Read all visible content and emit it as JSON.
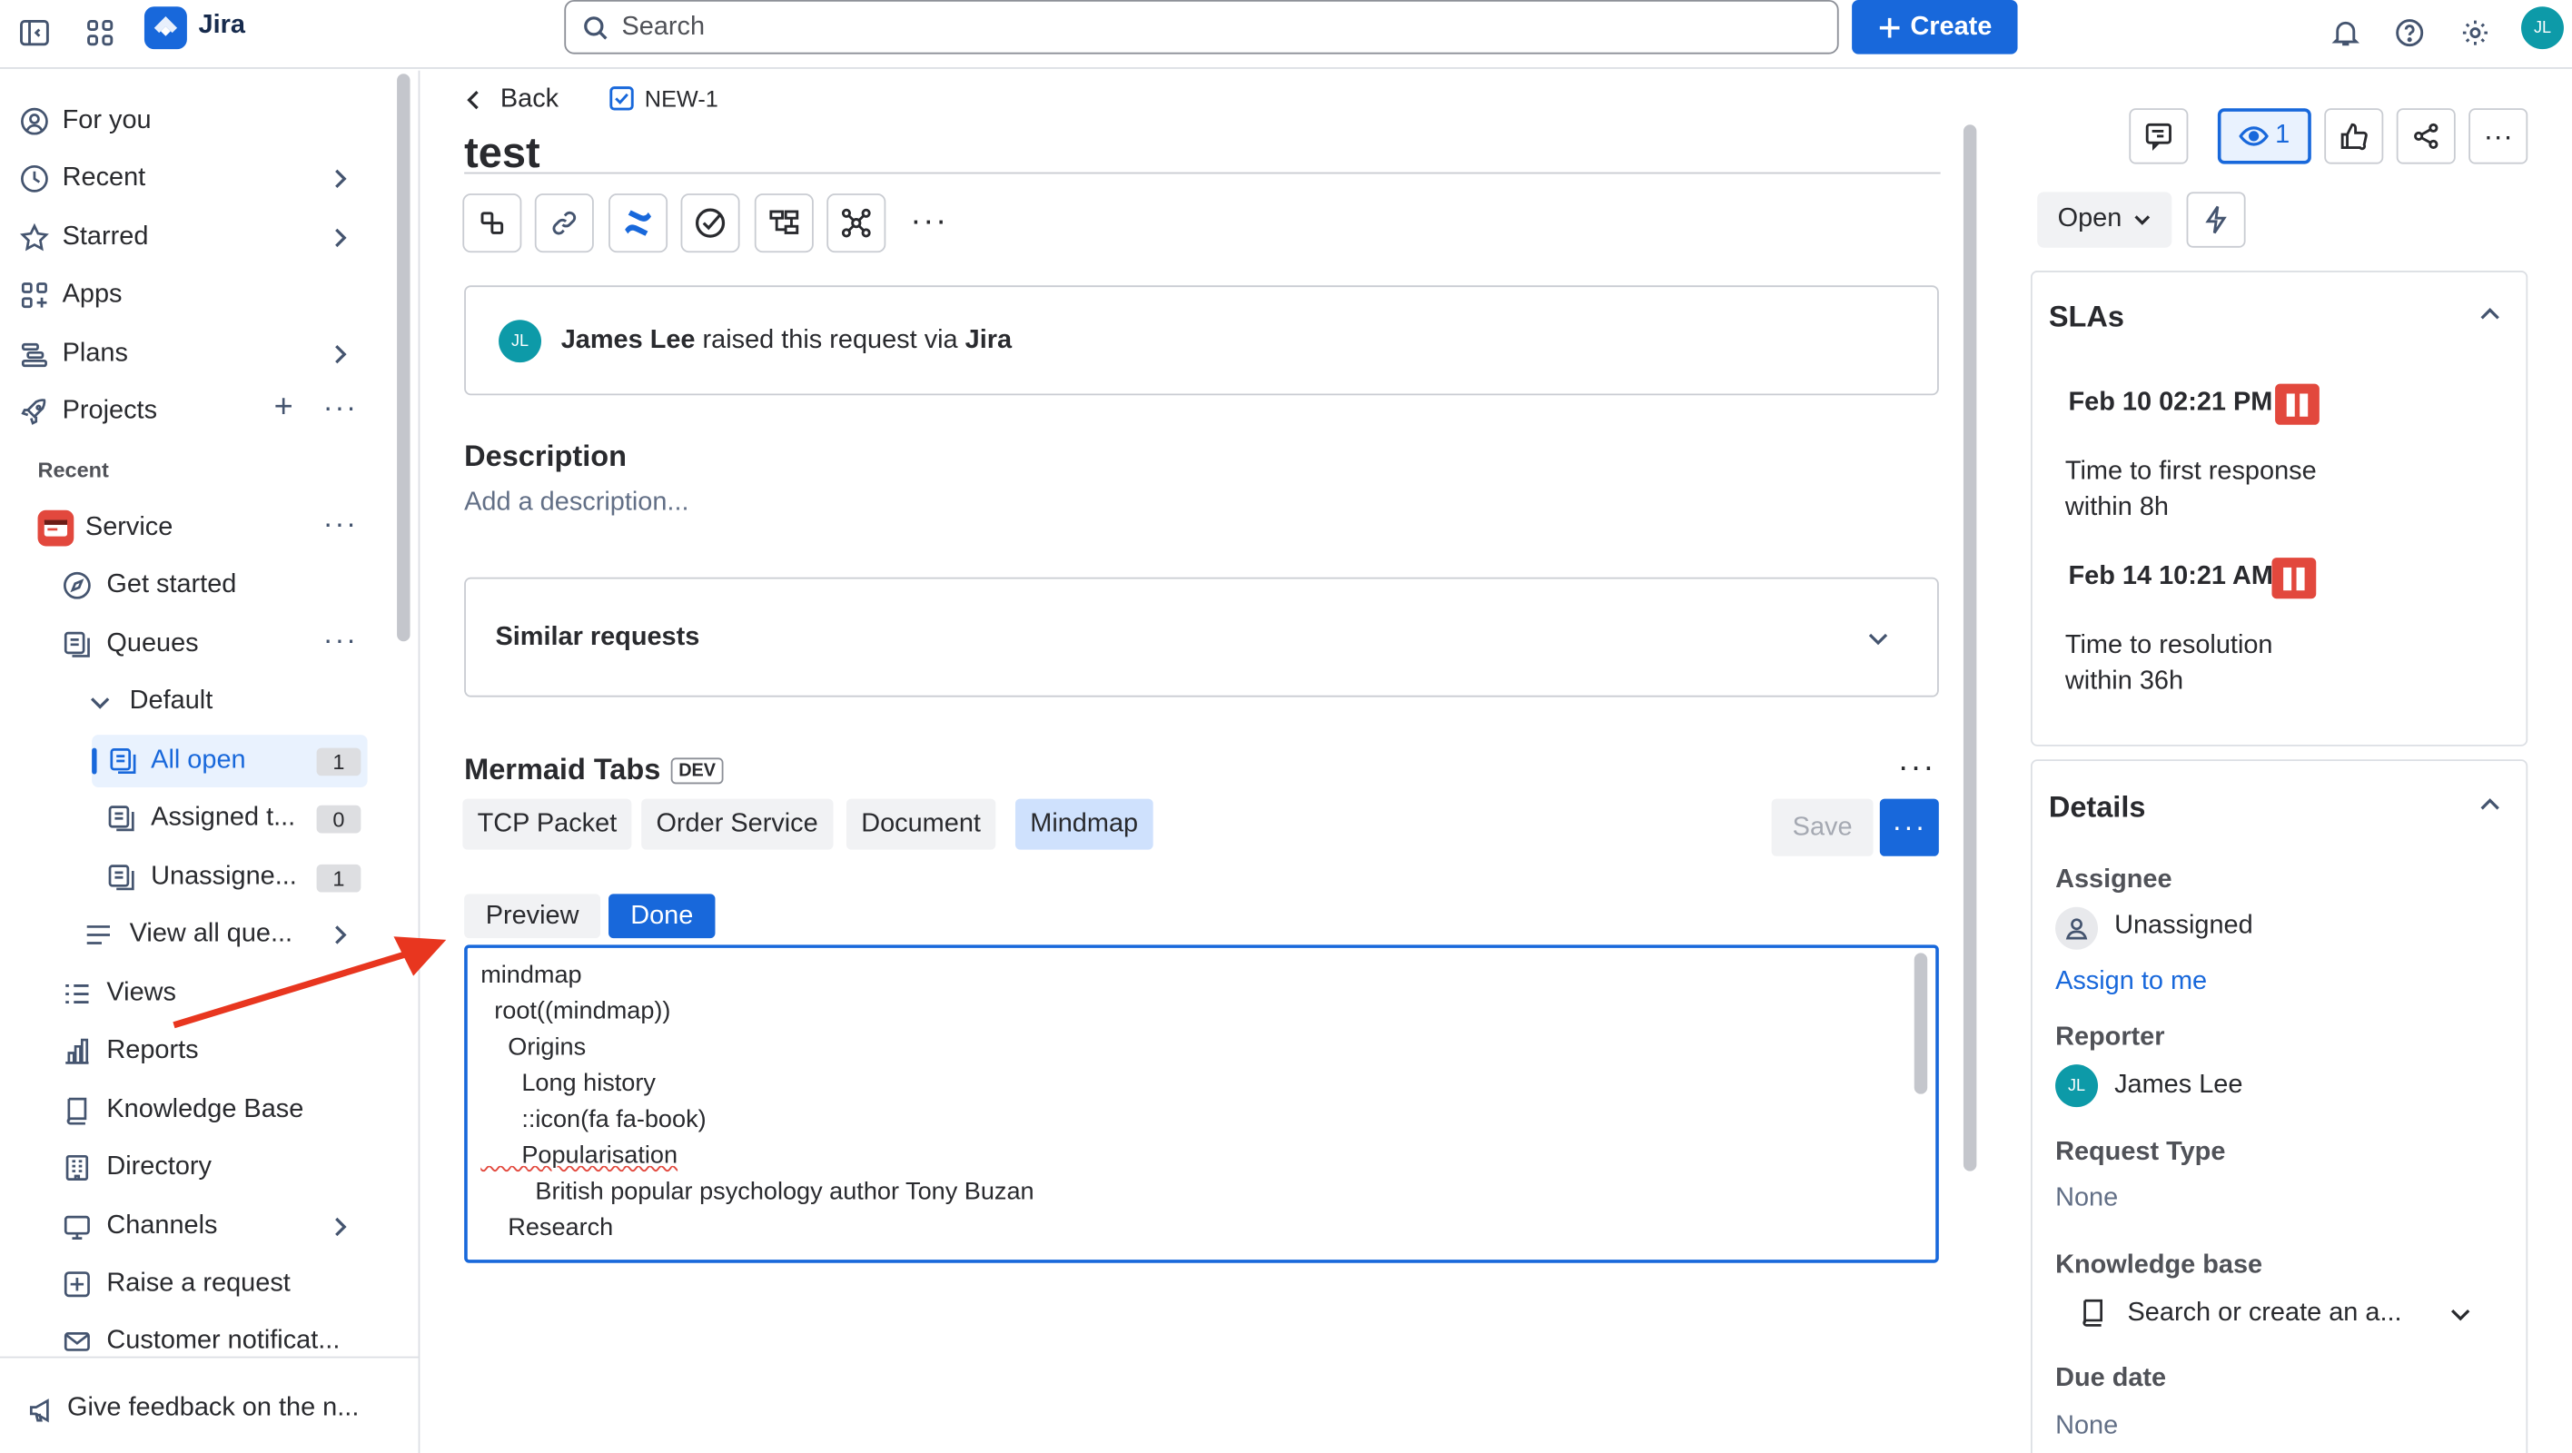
{
  "app": {
    "name": "Jira"
  },
  "topbar": {
    "search_placeholder": "Search",
    "create_label": "Create",
    "avatar_initials": "JL"
  },
  "sidebar": {
    "for_you": "For you",
    "recent": "Recent",
    "starred": "Starred",
    "apps": "Apps",
    "plans": "Plans",
    "projects": "Projects",
    "recent_header": "Recent",
    "service": "Service",
    "get_started": "Get started",
    "queues": "Queues",
    "default": "Default",
    "all_open": "All open",
    "all_open_count": "1",
    "assigned": "Assigned t...",
    "assigned_count": "0",
    "unassigned": "Unassigne...",
    "unassigned_count": "1",
    "view_all": "View all que...",
    "views": "Views",
    "reports": "Reports",
    "knowledge_base": "Knowledge Base",
    "directory": "Directory",
    "channels": "Channels",
    "raise_request": "Raise a request",
    "customer_notif": "Customer notificat...",
    "feedback": "Give feedback on the n..."
  },
  "issue": {
    "back_label": "Back",
    "key": "NEW-1",
    "title": "test",
    "raised_by": "James Lee",
    "raised_mid": " raised this request via ",
    "raised_via": "Jira",
    "reporter_initials": "JL",
    "description_heading": "Description",
    "description_placeholder": "Add a description...",
    "similar_requests": "Similar requests"
  },
  "mermaid": {
    "heading": "Mermaid Tabs",
    "badge": "DEV",
    "tabs": [
      "TCP Packet",
      "Order Service",
      "Document",
      "Mindmap"
    ],
    "save_label": "Save",
    "preview_label": "Preview",
    "done_label": "Done",
    "code_lines": [
      "mindmap",
      "  root((mindmap))",
      "    Origins",
      "      Long history",
      "      ::icon(fa fa-book)",
      "      Popularisation",
      "        British popular psychology author Tony Buzan",
      "    Research"
    ]
  },
  "right_panel": {
    "watch_count": "1",
    "status": "Open",
    "slas": {
      "heading": "SLAs",
      "items": [
        {
          "time": "Feb 10 02:21 PM",
          "label": "Time to first response",
          "within": "within 8h"
        },
        {
          "time": "Feb 14 10:21 AM",
          "label": "Time to resolution",
          "within": "within 36h"
        }
      ]
    },
    "details": {
      "heading": "Details",
      "assignee_label": "Assignee",
      "assignee_value": "Unassigned",
      "assign_to_me": "Assign to me",
      "reporter_label": "Reporter",
      "reporter_value": "James Lee",
      "reporter_initials": "JL",
      "request_type_label": "Request Type",
      "request_type_value": "None",
      "kb_label": "Knowledge base",
      "kb_placeholder": "Search or create an a...",
      "due_label": "Due date",
      "due_value": "None"
    }
  },
  "colors": {
    "brand": "#1868db",
    "sla_paused": "#e2483d",
    "annotation_arrow": "#e8361f"
  }
}
